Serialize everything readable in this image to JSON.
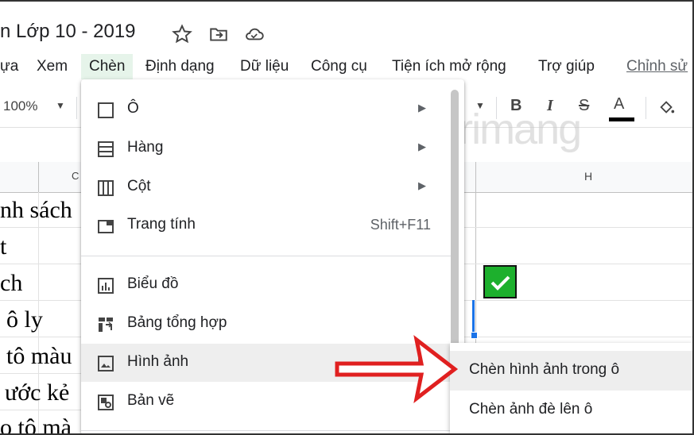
{
  "title": {
    "doc_name": "n Lớp 10 - 2019"
  },
  "menubar": {
    "items": [
      {
        "label": "ựa"
      },
      {
        "label": "Xem"
      },
      {
        "label": "Chèn"
      },
      {
        "label": "Định dạng"
      },
      {
        "label": "Dữ liệu"
      },
      {
        "label": "Công cụ"
      },
      {
        "label": "Tiện ích mở rộng"
      },
      {
        "label": "Trợ giúp"
      },
      {
        "label": "Chỉnh sử"
      }
    ]
  },
  "toolbar": {
    "zoom": "100%",
    "bold": "B",
    "italic": "I",
    "strike": "S",
    "text_color": "A"
  },
  "grid": {
    "col_headers": [
      "C",
      "H"
    ],
    "cells": [
      "nh sách",
      "t",
      "ch",
      "ô ly",
      "tô màu",
      "ước kẻ",
      "o tô mà"
    ]
  },
  "insert_menu": {
    "items": [
      {
        "label": "Ô",
        "icon": "cell-icon",
        "submenu": true
      },
      {
        "label": "Hàng",
        "icon": "row-icon",
        "submenu": true
      },
      {
        "label": "Cột",
        "icon": "column-icon",
        "submenu": true
      },
      {
        "label": "Trang tính",
        "icon": "sheet-icon",
        "shortcut": "Shift+F11"
      },
      {
        "label": "Biểu đồ",
        "icon": "chart-icon"
      },
      {
        "label": "Bảng tổng hợp",
        "icon": "pivot-table-icon"
      },
      {
        "label": "Hình ảnh",
        "icon": "image-icon",
        "submenu": true
      },
      {
        "label": "Bản vẽ",
        "icon": "drawing-icon"
      }
    ]
  },
  "image_submenu": {
    "items": [
      {
        "label": "Chèn hình ảnh trong ô"
      },
      {
        "label": "Chèn ảnh đè lên ô"
      }
    ]
  },
  "watermark": "uantrimang",
  "colors": {
    "active_menu_bg": "#e6f4ea",
    "check_green": "#1db02d",
    "arrow_red": "#e02020",
    "selection_blue": "#1a73e8"
  }
}
